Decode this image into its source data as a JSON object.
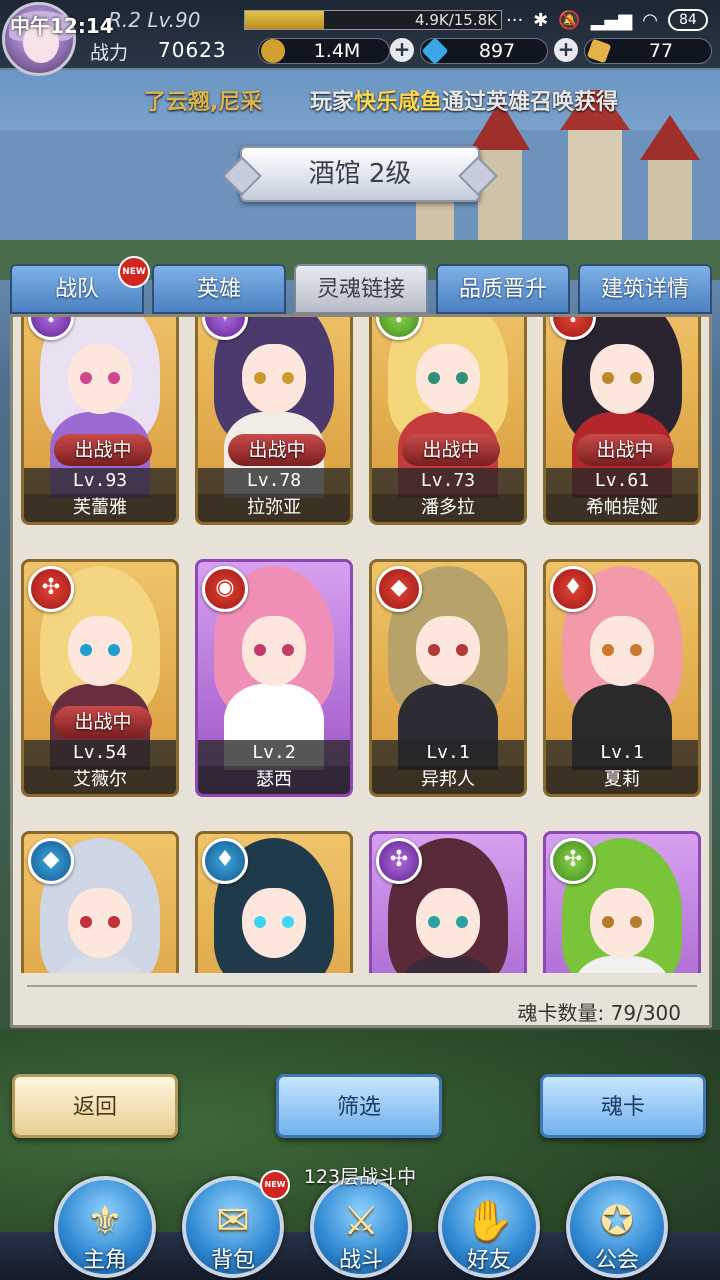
{
  "status": {
    "clock": "中午12:14",
    "level": "R.2 Lv.90",
    "exp_text": "4.9K/15.8K",
    "exp_fraction": 0.31,
    "battery": "84"
  },
  "player": {
    "power_label": "战力",
    "power_value": "70623"
  },
  "resources": [
    {
      "icon": "gold-coin-icon",
      "value": "1.4M",
      "color": "#d1a02e"
    },
    {
      "icon": "diamond-icon",
      "value": "897",
      "color": "#3aa7e6"
    },
    {
      "icon": "crystal-icon",
      "value": "77",
      "color": "#e6b146"
    }
  ],
  "ticker": {
    "part1": "了云翘,尼采",
    "part2_prefix": "玩家",
    "part2_name": "快乐咸鱼",
    "part2_suffix": "通过英雄召唤获得"
  },
  "title": "酒馆 2级",
  "tabs": [
    {
      "label": "战队",
      "badge": "NEW"
    },
    {
      "label": "英雄"
    },
    {
      "label": "灵魂链接",
      "active": true
    },
    {
      "label": "品质晋升"
    },
    {
      "label": "建筑详情"
    }
  ],
  "deploy_label": "出战中",
  "heroes": [
    {
      "name": "芙蕾雅",
      "level": "Lv.93",
      "deployed": true,
      "element": "purple",
      "symbol": "✣",
      "hair": "#e9e0f2",
      "outfit": "#9a6ad0",
      "eyes": "#d0468a"
    },
    {
      "name": "拉弥亚",
      "level": "Lv.78",
      "deployed": true,
      "element": "purple",
      "symbol": "✦",
      "hair": "#4b3a6e",
      "outfit": "#f1ece6",
      "eyes": "#c99a2a"
    },
    {
      "name": "潘多拉",
      "level": "Lv.73",
      "deployed": true,
      "element": "green",
      "symbol": "✣",
      "hair": "#f3d77a",
      "outfit": "#c53a3a",
      "eyes": "#2f8d7a"
    },
    {
      "name": "希帕提娅",
      "level": "Lv.61",
      "deployed": true,
      "element": "red",
      "symbol": "✣",
      "hair": "#2a2430",
      "outfit": "#b3262a",
      "eyes": "#b88a2a"
    },
    {
      "name": "艾薇尔",
      "level": "Lv.54",
      "deployed": true,
      "element": "red",
      "symbol": "✣",
      "hair": "#f4d582",
      "outfit": "#6a2f3e",
      "eyes": "#1a9fcf"
    },
    {
      "name": "瑟西",
      "level": "Lv.2",
      "deployed": false,
      "element": "red",
      "symbol": "◉",
      "hair": "#f08fb6",
      "outfit": "#ffffff",
      "eyes": "#c23a6a",
      "card": "purple"
    },
    {
      "name": "异邦人",
      "level": "Lv.1",
      "deployed": false,
      "element": "red",
      "symbol": "◆",
      "hair": "#b7a36a",
      "outfit": "#2c2c34",
      "eyes": "#b23a3a"
    },
    {
      "name": "夏莉",
      "level": "Lv.1",
      "deployed": false,
      "element": "red",
      "symbol": "♦",
      "hair": "#f39aa8",
      "outfit": "#2a2a2a",
      "eyes": "#c97a2a"
    },
    {
      "name": "",
      "level": "",
      "deployed": false,
      "element": "blue",
      "symbol": "◆",
      "hair": "#cfd6e6",
      "outfit": "#d7dbe6",
      "eyes": "#c2303a"
    },
    {
      "name": "",
      "level": "",
      "deployed": false,
      "element": "blue",
      "symbol": "♦",
      "hair": "#1f3a4a",
      "outfit": "#243a4c",
      "eyes": "#3ed5f0"
    },
    {
      "name": "",
      "level": "",
      "deployed": false,
      "element": "purple",
      "symbol": "✣",
      "hair": "#5a2a3a",
      "outfit": "#3a2a3a",
      "eyes": "#2aa0a0",
      "card": "purple"
    },
    {
      "name": "",
      "level": "",
      "deployed": false,
      "element": "green",
      "symbol": "✣",
      "hair": "#7ac43a",
      "outfit": "#f1f1f1",
      "eyes": "#b87a2a",
      "card": "purple"
    }
  ],
  "soul_card_count": "魂卡数量: 79/300",
  "buttons": {
    "back": "返回",
    "filter": "筛选",
    "soul_card": "魂卡"
  },
  "battle_status": "123层战斗中",
  "nav": [
    {
      "label": "主角",
      "icon": "helmet-icon",
      "glyph": "⚜"
    },
    {
      "label": "背包",
      "icon": "backpack-icon",
      "glyph": "✉",
      "badge": "NEW"
    },
    {
      "label": "战斗",
      "icon": "crossed-swords-icon",
      "glyph": "⚔"
    },
    {
      "label": "好友",
      "icon": "handshake-icon",
      "glyph": "✋"
    },
    {
      "label": "公会",
      "icon": "guild-crest-icon",
      "glyph": "✪"
    }
  ]
}
